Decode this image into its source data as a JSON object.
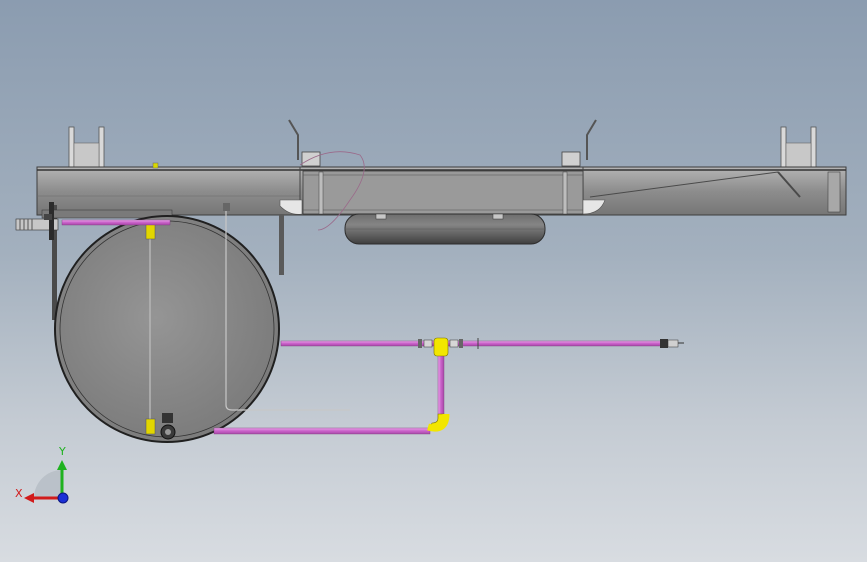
{
  "viewport": {
    "triad": {
      "x_label": "X",
      "y_label": "Y",
      "x_color": "#d11b1b",
      "y_color": "#1fb21f",
      "z_color": "#1a2fd6"
    },
    "colors": {
      "frame": "#8e8e8e",
      "frame_dark": "#5c5c5c",
      "tank": "#8a8a8a",
      "pipe": "#d67ad6",
      "fitting": "#f2e600"
    }
  }
}
